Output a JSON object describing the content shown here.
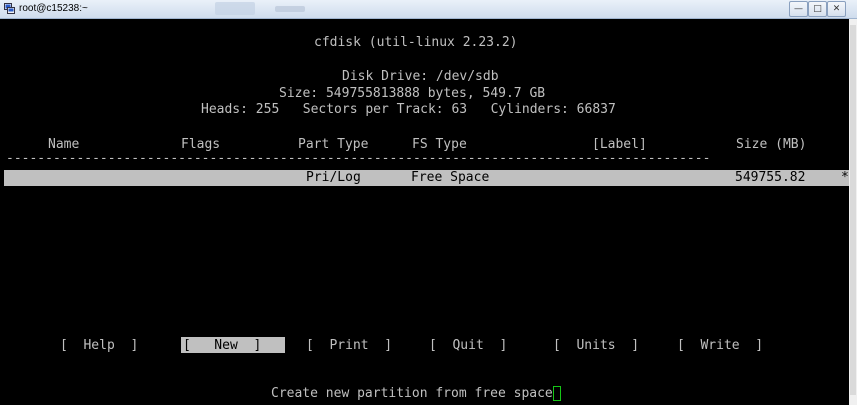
{
  "window": {
    "title": "root@c15238:~",
    "controls": [
      "minimize",
      "maximize",
      "close"
    ]
  },
  "terminal": {
    "app_title": "cfdisk (util-linux 2.23.2)",
    "disk_drive": "Disk Drive: /dev/sdb",
    "size_line": "Size: 549755813888 bytes, 549.7 GB",
    "geometry_line": "Heads: 255   Sectors per Track: 63   Cylinders: 66837",
    "columns": {
      "name": "Name",
      "flags": "Flags",
      "part_type": "Part Type",
      "fs_type": "FS Type",
      "label": "[Label]",
      "size": "Size (MB)"
    },
    "separator": "------------------------------------------------------------------------------------------",
    "partitions": [
      {
        "name": "",
        "flags": "",
        "part_type": "Pri/Log",
        "fs_type": "Free Space",
        "label": "",
        "size": "549755.82",
        "marker": "*"
      }
    ],
    "menu": [
      {
        "label": "[  Help  ]"
      },
      {
        "label": "[   New  ]",
        "selected": true
      },
      {
        "label": "[  Print  ]"
      },
      {
        "label": "[  Quit  ]"
      },
      {
        "label": "[  Units  ]"
      },
      {
        "label": "[  Write  ]"
      }
    ],
    "status": "Create new partition from free space"
  },
  "colors": {
    "terminal_bg": "#000000",
    "terminal_fg": "#c0c0c0",
    "highlight_bg": "#c0c0c0",
    "cursor": "#16c616"
  }
}
